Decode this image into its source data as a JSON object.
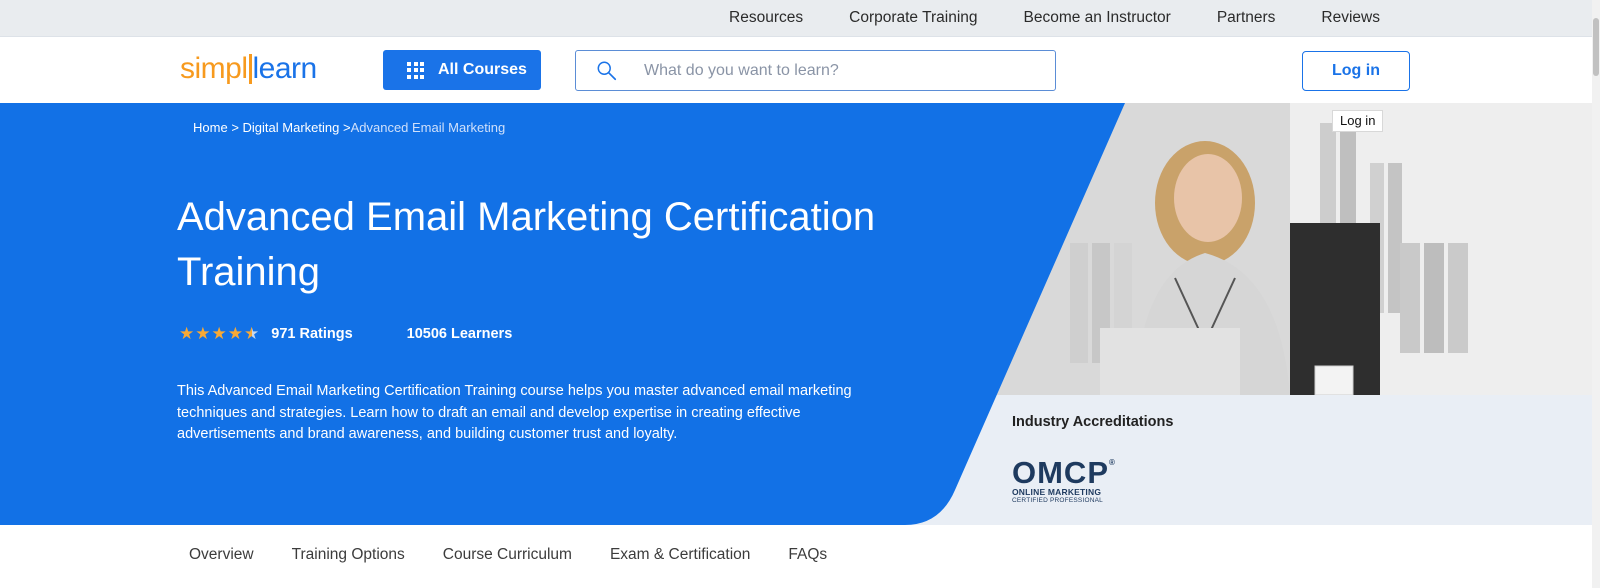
{
  "topbar": {
    "links": [
      "Resources",
      "Corporate Training",
      "Become an Instructor",
      "Partners",
      "Reviews"
    ]
  },
  "header": {
    "logo": {
      "part1": "simpl",
      "part2": "learn"
    },
    "all_courses_label": "All Courses",
    "search_placeholder": "What do you want to learn?",
    "login_label": "Log in"
  },
  "breadcrumb": {
    "home": "Home",
    "sep": ">",
    "category": "Digital Marketing",
    "current": "Advanced Email Marketing"
  },
  "hero": {
    "title": "Advanced Email Marketing Certification Training",
    "rating_value": 4.5,
    "ratings_label": "971 Ratings",
    "learners_label": "10506 Learners",
    "description": "This Advanced Email Marketing Certification Training course helps you master advanced email marketing techniques and strategies. Learn how to draft an email and develop expertise in creating effective advertisements and brand awareness, and building customer trust and loyalty."
  },
  "tooltip": {
    "text": "Log in"
  },
  "accreditation": {
    "title": "Industry Accreditations",
    "logo_text": "OMCP",
    "logo_line1": "ONLINE MARKETING",
    "logo_line2": "CERTIFIED PROFESSIONAL"
  },
  "tabs": [
    "Overview",
    "Training Options",
    "Course Curriculum",
    "Exam & Certification",
    "FAQs"
  ],
  "colors": {
    "brand_blue": "#1a73e8",
    "brand_orange": "#f79a1e",
    "star": "#f7a935"
  }
}
